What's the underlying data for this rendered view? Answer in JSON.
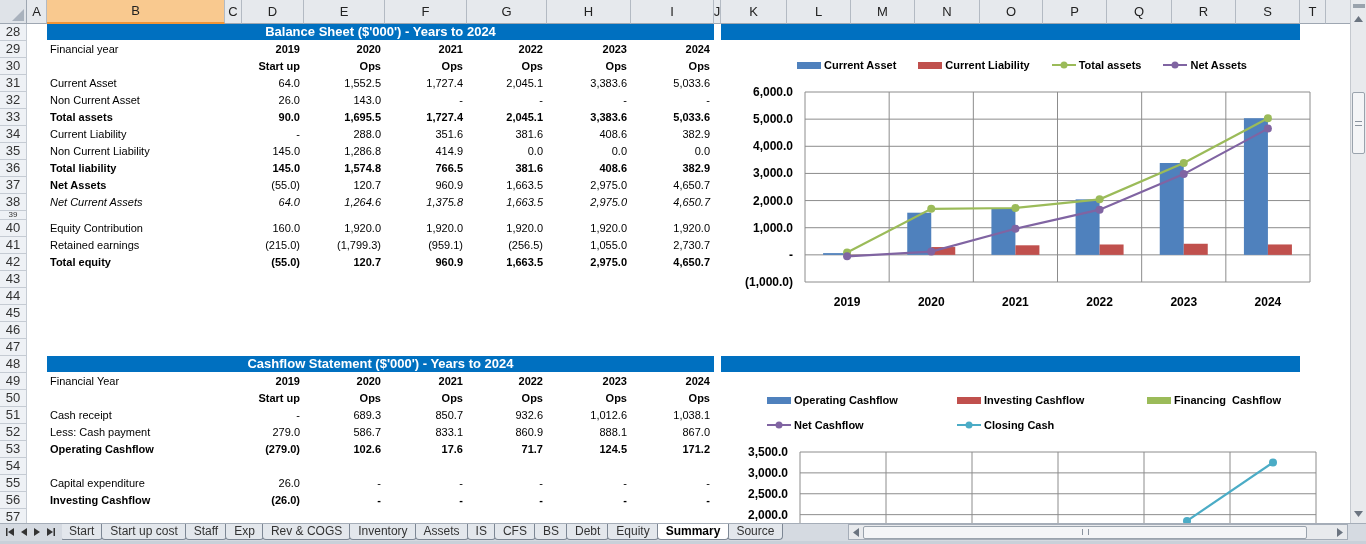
{
  "column_headers": [
    {
      "label": "A",
      "selected": false
    },
    {
      "label": "B",
      "selected": true
    },
    {
      "label": "C",
      "selected": false
    },
    {
      "label": "D",
      "selected": false
    },
    {
      "label": "E",
      "selected": false
    },
    {
      "label": "F",
      "selected": false
    },
    {
      "label": "G",
      "selected": false
    },
    {
      "label": "H",
      "selected": false
    },
    {
      "label": "I",
      "selected": false
    },
    {
      "label": "J",
      "selected": false
    },
    {
      "label": "K",
      "selected": false
    },
    {
      "label": "L",
      "selected": false
    },
    {
      "label": "M",
      "selected": false
    },
    {
      "label": "N",
      "selected": false
    },
    {
      "label": "O",
      "selected": false
    },
    {
      "label": "P",
      "selected": false
    },
    {
      "label": "Q",
      "selected": false
    },
    {
      "label": "R",
      "selected": false
    },
    {
      "label": "S",
      "selected": false
    },
    {
      "label": "T",
      "selected": false
    }
  ],
  "rows": [
    {
      "number": "28",
      "kind": "banner",
      "title": "Balance Sheet ($'000') - Years to 2024"
    },
    {
      "number": "29",
      "kind": "data",
      "label": "Financial year",
      "label_bold": false,
      "values_bold": true,
      "italic": false,
      "values": [
        "2019",
        "2020",
        "2021",
        "2022",
        "2023",
        "2024"
      ]
    },
    {
      "number": "30",
      "kind": "data",
      "values_bold": true,
      "italic": false,
      "values": [
        "Start up",
        "Ops",
        "Ops",
        "Ops",
        "Ops",
        "Ops"
      ]
    },
    {
      "number": "31",
      "kind": "data",
      "label": "Current Asset",
      "label_bold": false,
      "values_bold": false,
      "italic": false,
      "values": [
        "64.0",
        "1,552.5",
        "1,727.4",
        "2,045.1",
        "3,383.6",
        "5,033.6"
      ]
    },
    {
      "number": "32",
      "kind": "data",
      "label": "Non Current Asset",
      "label_bold": false,
      "values_bold": false,
      "italic": false,
      "values": [
        "26.0",
        "143.0",
        "-",
        "-",
        "-",
        "-"
      ]
    },
    {
      "number": "33",
      "kind": "data",
      "label": "Total assets",
      "label_bold": true,
      "values_bold": true,
      "italic": false,
      "values": [
        "90.0",
        "1,695.5",
        "1,727.4",
        "2,045.1",
        "3,383.6",
        "5,033.6"
      ]
    },
    {
      "number": "34",
      "kind": "data",
      "label": "Current Liability",
      "label_bold": false,
      "values_bold": false,
      "italic": false,
      "values": [
        "-",
        "288.0",
        "351.6",
        "381.6",
        "408.6",
        "382.9"
      ]
    },
    {
      "number": "35",
      "kind": "data",
      "label": "Non Current Liability",
      "label_bold": false,
      "values_bold": false,
      "italic": false,
      "values": [
        "145.0",
        "1,286.8",
        "414.9",
        "0.0",
        "0.0",
        "0.0"
      ]
    },
    {
      "number": "36",
      "kind": "data",
      "label": "Total liability",
      "label_bold": true,
      "values_bold": true,
      "italic": false,
      "values": [
        "145.0",
        "1,574.8",
        "766.5",
        "381.6",
        "408.6",
        "382.9"
      ]
    },
    {
      "number": "37",
      "kind": "data",
      "label": "Net Assets",
      "label_bold": true,
      "values_bold": false,
      "italic": false,
      "values": [
        "(55.0)",
        "120.7",
        "960.9",
        "1,663.5",
        "2,975.0",
        "4,650.7"
      ]
    },
    {
      "number": "38",
      "kind": "data",
      "label": "Net Current Assets",
      "label_bold": false,
      "values_bold": false,
      "italic": true,
      "values": [
        "64.0",
        "1,264.6",
        "1,375.8",
        "1,663.5",
        "2,975.0",
        "4,650.7"
      ]
    },
    {
      "number": "39",
      "kind": "short"
    },
    {
      "number": "40",
      "kind": "data",
      "label": "Equity Contribution",
      "label_bold": false,
      "values_bold": false,
      "italic": false,
      "values": [
        "160.0",
        "1,920.0",
        "1,920.0",
        "1,920.0",
        "1,920.0",
        "1,920.0"
      ]
    },
    {
      "number": "41",
      "kind": "data",
      "label": "Retained earnings",
      "label_bold": false,
      "values_bold": false,
      "italic": false,
      "values": [
        "(215.0)",
        "(1,799.3)",
        "(959.1)",
        "(256.5)",
        "1,055.0",
        "2,730.7"
      ]
    },
    {
      "number": "42",
      "kind": "data",
      "label": "Total equity",
      "label_bold": true,
      "values_bold": true,
      "italic": false,
      "values": [
        "(55.0)",
        "120.7",
        "960.9",
        "1,663.5",
        "2,975.0",
        "4,650.7"
      ]
    },
    {
      "number": "43",
      "kind": "empty"
    },
    {
      "number": "44",
      "kind": "empty"
    },
    {
      "number": "45",
      "kind": "empty"
    },
    {
      "number": "46",
      "kind": "empty"
    },
    {
      "number": "47",
      "kind": "empty"
    },
    {
      "number": "48",
      "kind": "banner",
      "title": "Cashflow Statement ($'000') - Years to 2024"
    },
    {
      "number": "49",
      "kind": "data",
      "label": "Financial Year",
      "label_bold": false,
      "values_bold": true,
      "italic": false,
      "values": [
        "2019",
        "2020",
        "2021",
        "2022",
        "2023",
        "2024"
      ]
    },
    {
      "number": "50",
      "kind": "data",
      "values_bold": true,
      "italic": false,
      "values": [
        "Start up",
        "Ops",
        "Ops",
        "Ops",
        "Ops",
        "Ops"
      ]
    },
    {
      "number": "51",
      "kind": "data",
      "label": "Cash receipt",
      "label_bold": false,
      "values_bold": false,
      "italic": false,
      "values": [
        "-",
        "689.3",
        "850.7",
        "932.6",
        "1,012.6",
        "1,038.1"
      ]
    },
    {
      "number": "52",
      "kind": "data",
      "label": "Less: Cash payment",
      "label_bold": false,
      "values_bold": false,
      "italic": false,
      "values": [
        "279.0",
        "586.7",
        "833.1",
        "860.9",
        "888.1",
        "867.0"
      ]
    },
    {
      "number": "53",
      "kind": "data",
      "label": "Operating Cashflow",
      "label_bold": true,
      "values_bold": true,
      "italic": false,
      "values": [
        "(279.0)",
        "102.6",
        "17.6",
        "71.7",
        "124.5",
        "171.2"
      ]
    },
    {
      "number": "54",
      "kind": "empty"
    },
    {
      "number": "55",
      "kind": "data",
      "label": "Capital expenditure",
      "label_bold": false,
      "values_bold": false,
      "italic": false,
      "values": [
        "26.0",
        "-",
        "-",
        "-",
        "-",
        "-"
      ]
    },
    {
      "number": "56",
      "kind": "data",
      "label": "Investing Cashflow",
      "label_bold": true,
      "values_bold": true,
      "italic": false,
      "values": [
        "(26.0)",
        "-",
        "-",
        "-",
        "-",
        "-"
      ]
    },
    {
      "number": "57",
      "kind": "empty"
    }
  ],
  "balance_chart": {
    "chart_data": {
      "type": "bar",
      "stacked": false,
      "grid": true,
      "legend": true,
      "categories": [
        "2019",
        "2020",
        "2021",
        "2022",
        "2023",
        "2024"
      ],
      "ylim": [
        -1000,
        6000
      ],
      "yticks": [
        {
          "value": -1000,
          "label": "(1,000.0)"
        },
        {
          "value": 0,
          "label": "-"
        },
        {
          "value": 1000,
          "label": "1,000.0"
        },
        {
          "value": 2000,
          "label": "2,000.0"
        },
        {
          "value": 3000,
          "label": "3,000.0"
        },
        {
          "value": 4000,
          "label": "4,000.0"
        },
        {
          "value": 5000,
          "label": "5,000.0"
        },
        {
          "value": 6000,
          "label": "6,000.0"
        }
      ],
      "series": [
        {
          "name": "Current Asset",
          "type": "bar",
          "color": "#4f81bd",
          "values": [
            64,
            1553,
            1727,
            2045,
            3384,
            5034
          ]
        },
        {
          "name": "Current Liability",
          "type": "bar",
          "color": "#c0504d",
          "values": [
            0,
            288,
            352,
            382,
            409,
            383
          ]
        },
        {
          "name": "Total assets",
          "type": "line",
          "marker": true,
          "color": "#9bbb59",
          "values": [
            90,
            1696,
            1727,
            2045,
            3384,
            5034
          ]
        },
        {
          "name": "Net Assets",
          "type": "line",
          "marker": true,
          "color": "#8064a2",
          "values": [
            -55,
            121,
            961,
            1664,
            2975,
            4651
          ]
        }
      ]
    }
  },
  "cashflow_chart": {
    "chart_data": {
      "type": "bar",
      "grid": true,
      "legend": true,
      "ylim": [
        1800,
        3500
      ],
      "yticks": [
        {
          "value": 2000,
          "label": "2,000.0"
        },
        {
          "value": 2500,
          "label": "2,500.0"
        },
        {
          "value": 3000,
          "label": "3,000.0"
        },
        {
          "value": 3500,
          "label": "3,500.0"
        }
      ],
      "series": [
        {
          "name": "Operating Cashflow",
          "type": "bar",
          "color": "#4f81bd",
          "values": [
            null,
            null,
            null,
            null,
            null,
            null
          ]
        },
        {
          "name": "Investing Cashflow",
          "type": "bar",
          "color": "#c0504d",
          "values": [
            null,
            null,
            null,
            null,
            null,
            null
          ]
        },
        {
          "name": "Financing  Cashflow",
          "type": "bar",
          "color": "#9bbb59",
          "values": [
            null,
            null,
            null,
            null,
            null,
            null
          ]
        },
        {
          "name": "Net Cashflow",
          "type": "line",
          "marker": true,
          "color": "#8064a2",
          "values": [
            null,
            null,
            null,
            null,
            null,
            null
          ]
        },
        {
          "name": "Closing Cash",
          "type": "line",
          "marker": true,
          "color": "#4bacc6",
          "values": [
            null,
            null,
            null,
            null,
            1850,
            3250
          ]
        }
      ]
    }
  },
  "sheet_tabs": [
    {
      "label": "Start",
      "selected": false
    },
    {
      "label": "Start up cost",
      "selected": false
    },
    {
      "label": "Staff",
      "selected": false
    },
    {
      "label": "Exp",
      "selected": false
    },
    {
      "label": "Rev & COGS",
      "selected": false
    },
    {
      "label": "Inventory",
      "selected": false
    },
    {
      "label": "Assets",
      "selected": false
    },
    {
      "label": "IS",
      "selected": false
    },
    {
      "label": "CFS",
      "selected": false
    },
    {
      "label": "BS",
      "selected": false
    },
    {
      "label": "Debt",
      "selected": false
    },
    {
      "label": "Equity",
      "selected": false
    },
    {
      "label": "Summary",
      "selected": true
    },
    {
      "label": "Source",
      "selected": false
    }
  ]
}
